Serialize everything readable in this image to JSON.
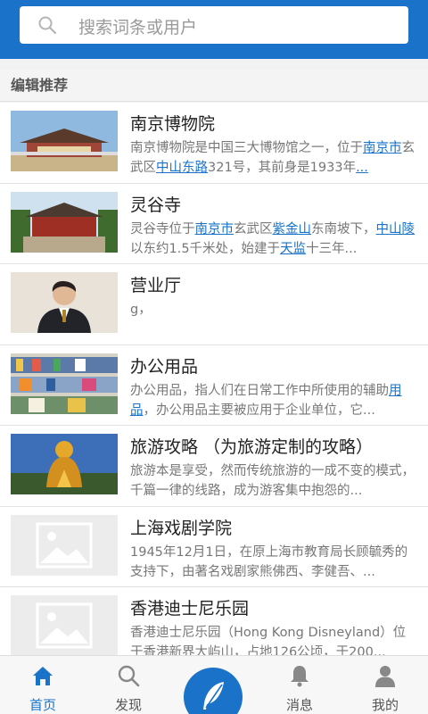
{
  "search": {
    "placeholder": "搜索词条或用户"
  },
  "section": {
    "title": "编辑推荐"
  },
  "items": [
    {
      "title": "南京博物院",
      "desc": [
        {
          "t": "南京博物院是中国三大博物馆之一，位于"
        },
        {
          "t": "南京市",
          "link": true
        },
        {
          "t": "玄武区"
        },
        {
          "t": "中山东路",
          "link": true
        },
        {
          "t": "321号，其前身是1933年"
        },
        {
          "t": "...",
          "link": true
        }
      ],
      "thumb": "museum"
    },
    {
      "title": "灵谷寺",
      "desc": [
        {
          "t": "灵谷寺位于"
        },
        {
          "t": "南京市",
          "link": true
        },
        {
          "t": "玄武区"
        },
        {
          "t": "紫金山",
          "link": true
        },
        {
          "t": "东南坡下，"
        },
        {
          "t": "中山陵",
          "link": true
        },
        {
          "t": "以东约1.5千米处，始建于"
        },
        {
          "t": "天监",
          "link": true
        },
        {
          "t": "十三年..."
        }
      ],
      "thumb": "temple"
    },
    {
      "title": "营业厅",
      "desc": [
        {
          "t": "g，"
        }
      ],
      "thumb": "person"
    },
    {
      "title": "办公用品",
      "desc": [
        {
          "t": "办公用品，指人们在日常工作中所使用的辅助"
        },
        {
          "t": "用品",
          "link": true
        },
        {
          "t": "，办公用品主要被应用于企业单位，它..."
        }
      ],
      "thumb": "shelves"
    },
    {
      "title": "旅游攻略 （为旅游定制的攻略）",
      "desc": [
        {
          "t": "旅游本是享受，然而传统旅游的一成不变的模式，千篇一律的线路，成为游客集中抱怨的..."
        }
      ],
      "thumb": "statue"
    },
    {
      "title": "上海戏剧学院",
      "desc": [
        {
          "t": "1945年12月1日，在原上海市教育局长顾毓秀的支持下，由著名戏剧家熊佛西、李健吾、..."
        }
      ],
      "thumb": "placeholder"
    },
    {
      "title": "香港迪士尼乐园",
      "desc": [
        {
          "t": "香港迪士尼乐园（Hong Kong Disneyland）位于香港新界大屿山，占地126公顷，于200..."
        }
      ],
      "thumb": "placeholder"
    }
  ],
  "tabs": [
    {
      "label": "首页",
      "icon": "home-icon",
      "active": true
    },
    {
      "label": "发现",
      "icon": "search-icon",
      "active": false
    },
    {
      "label": "",
      "icon": "feather-icon",
      "active": false
    },
    {
      "label": "消息",
      "icon": "bell-icon",
      "active": false
    },
    {
      "label": "我的",
      "icon": "user-icon",
      "active": false
    }
  ],
  "colors": {
    "primary": "#1a73c9",
    "link": "#1a73c9"
  }
}
